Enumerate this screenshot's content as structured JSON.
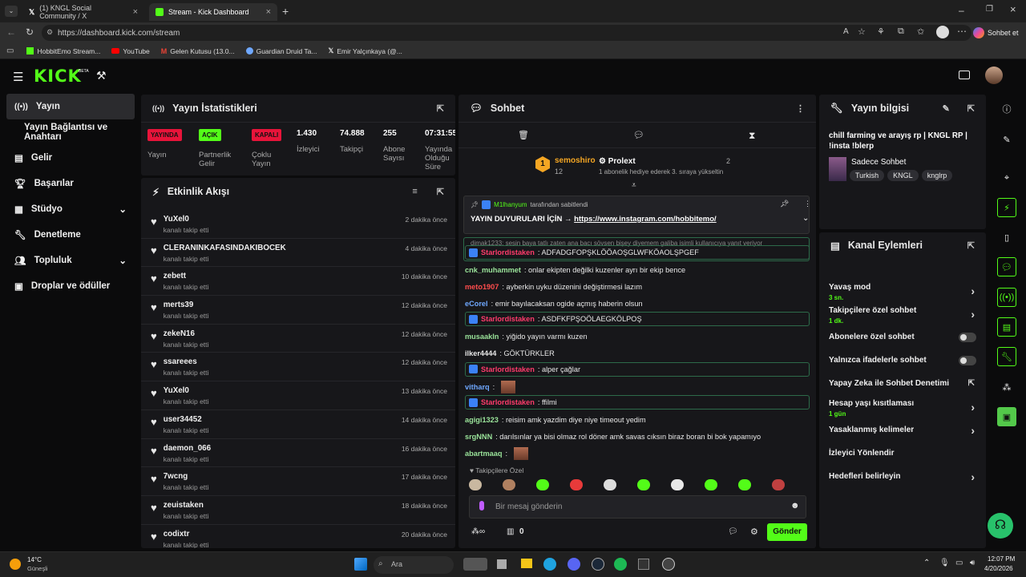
{
  "browser": {
    "tabs": [
      {
        "label": "(1) KNGL Social Community / X"
      },
      {
        "label": "Stream - Kick Dashboard"
      }
    ],
    "url": "https://dashboard.kick.com/stream",
    "sohbet_button": "Sohbet et",
    "bookmarks": [
      {
        "label": "HobbitEmo Stream..."
      },
      {
        "label": "YouTube"
      },
      {
        "label": "Gelen Kutusu (13.0..."
      },
      {
        "label": "Guardian Druid Ta..."
      },
      {
        "label": "Emir Yalçınkaya (@..."
      }
    ]
  },
  "app": {
    "logo": "KICK",
    "beta": "BETA"
  },
  "sidebar": {
    "items": [
      {
        "label": "Yayın"
      },
      {
        "label": "Yayın Bağlantısı ve Anahtarı"
      },
      {
        "label": "Gelir"
      },
      {
        "label": "Başarılar"
      },
      {
        "label": "Stüdyo"
      },
      {
        "label": "Denetleme"
      },
      {
        "label": "Topluluk"
      },
      {
        "label": "Droplar ve ödüller"
      }
    ]
  },
  "stats": {
    "title": "Yayın İstatistikleri",
    "cols": [
      {
        "badge": "YAYINDA",
        "label": "Yayın"
      },
      {
        "badge": "AÇIK",
        "label": "Partnerlik Gelir"
      },
      {
        "badge": "KAPALI",
        "label": "Çoklu Yayın"
      },
      {
        "value": "1.430",
        "label": "İzleyici"
      },
      {
        "value": "74.888",
        "label": "Takipçi"
      },
      {
        "value": "255",
        "label": "Abone Sayısı"
      },
      {
        "value": "07:31:55",
        "label": "Yayında Olduğu Süre"
      }
    ]
  },
  "activity": {
    "title": "Etkinlik Akışı",
    "sub": "kanalı takip etti",
    "items": [
      {
        "name": "YuXel0",
        "time": "2 dakika önce"
      },
      {
        "name": "CLERANINKAFASINDAKIBOCEK",
        "time": "4 dakika önce"
      },
      {
        "name": "zebett",
        "time": "10 dakika önce"
      },
      {
        "name": "merts39",
        "time": "12 dakika önce"
      },
      {
        "name": "zekeN16",
        "time": "12 dakika önce"
      },
      {
        "name": "ssareees",
        "time": "12 dakika önce"
      },
      {
        "name": "YuXel0",
        "time": "13 dakika önce"
      },
      {
        "name": "user34452",
        "time": "14 dakika önce"
      },
      {
        "name": "daemon_066",
        "time": "16 dakika önce"
      },
      {
        "name": "7wcng",
        "time": "17 dakika önce"
      },
      {
        "name": "zeuistaken",
        "time": "18 dakika önce"
      },
      {
        "name": "codixtr",
        "time": "20 dakika önce"
      }
    ]
  },
  "chat": {
    "title": "Sohbet",
    "leader1": {
      "rank": "1",
      "name": "semoshiro",
      "count": "12"
    },
    "leader2": {
      "name": "Prolext",
      "count": "2",
      "note": "1 abonelik hediye ederek 3. sıraya yükseltin"
    },
    "pinned": {
      "by": "M1lhanyum",
      "by_suffix": "tarafından sabitlendi",
      "text": "YAYIN DUYURULARI İÇİN →",
      "link": "https://www.instagram.com/hobbitemo/"
    },
    "reply_note": "dimak1233: sesin baya tatlı zaten ana bacı sövsen bişey diyemem galiba isimli kullanıcıya yanıt veriyor",
    "messages": [
      {
        "user": "Starlordistaken",
        "text": ": ADFADGFOPŞKLÖÖAOŞGLWFKÖAOLŞPGEF",
        "color": "#ff3b6b",
        "box": true
      },
      {
        "user": "cnk_muhammet",
        "text": ": onlar ekipten değilki kuzenler ayrı bir ekip bence",
        "color": "#9ae39a",
        "box": false
      },
      {
        "user": "meto1907",
        "text": ": ayberkin uyku düzenini değiştirmesi lazım",
        "color": "#ff4d4d",
        "box": false
      },
      {
        "user": "eCorel",
        "text": ": emir bayılacaksan ogide açmış haberin olsun",
        "color": "#6fa8ff",
        "box": false
      },
      {
        "user": "Starlordistaken",
        "text": ": ASDFKFPŞOÖLAEGKÖLPOŞ",
        "color": "#ff3b6b",
        "box": true
      },
      {
        "user": "musaakln",
        "text": ": yiğido yayın varmı kuzen",
        "color": "#9ae39a",
        "box": false
      },
      {
        "user": "ilker4444",
        "text": ": GÖKTÜRKLER",
        "color": "#e8e8e8",
        "box": false
      },
      {
        "user": "Starlordistaken",
        "text": ": alper çağlar",
        "color": "#ff3b6b",
        "box": true
      },
      {
        "user": "vitharq",
        "text": ":",
        "color": "#6fa8ff",
        "box": false
      },
      {
        "user": "Starlordistaken",
        "text": ": ffilmi",
        "color": "#ff3b6b",
        "box": true
      },
      {
        "user": "agigi1323",
        "text": ": reisim amk yazdim diye niye timeout yedim",
        "color": "#9ae39a",
        "box": false
      },
      {
        "user": "srgNNN",
        "text": ": darılsınlar ya bisi olmaz rol döner amk savas cıksın biraz boran bi bok yapamıyo",
        "color": "#9ae39a",
        "box": false
      },
      {
        "user": "abartmaaq",
        "text": ":",
        "color": "#9ae39a",
        "box": false
      }
    ],
    "followers_only": "Takipçilere Özel",
    "input_placeholder": "Bir mesaj gönderin",
    "counter": "0",
    "send": "Gönder"
  },
  "info": {
    "title": "Yayın bilgisi",
    "stream_title": "chill farming ve arayış rp | KNGL RP | !insta !blerp",
    "category": "Sadece Sohbet",
    "tags": [
      "Turkish",
      "KNGL",
      "knglrp"
    ]
  },
  "actions": {
    "title": "Kanal Eylemleri",
    "items": [
      {
        "label": "Yavaş mod",
        "sub": "3 sn.",
        "ctrl": "chev"
      },
      {
        "label": "Takipçilere özel sohbet",
        "sub": "1 dk.",
        "ctrl": "chev"
      },
      {
        "label": "Abonelere özel sohbet",
        "sub": "",
        "ctrl": "toggle"
      },
      {
        "label": "Yalnızca ifadelerle sohbet",
        "sub": "",
        "ctrl": "toggle"
      },
      {
        "label": "Yapay Zeka ile Sohbet Denetimi",
        "sub": "",
        "ctrl": "ext"
      },
      {
        "label": "Hesap yaşı kısıtlaması",
        "sub": "1 gün",
        "ctrl": "chev"
      },
      {
        "label": "Yasaklanmış kelimeler",
        "sub": "",
        "ctrl": "chev"
      },
      {
        "label": "İzleyici Yönlendir",
        "sub": "",
        "ctrl": "none"
      },
      {
        "label": "Hedefleri belirleyin",
        "sub": "",
        "ctrl": "chev"
      }
    ]
  },
  "taskbar": {
    "weather_temp": "14°C",
    "weather_desc": "Güneşli",
    "search": "Ara",
    "time": "12:07 PM",
    "date": "4/20/2026"
  },
  "colors": {
    "accent": "#53fc18",
    "panel": "#17171a",
    "bg": "#0b0b0c",
    "live": "#e8143a"
  }
}
